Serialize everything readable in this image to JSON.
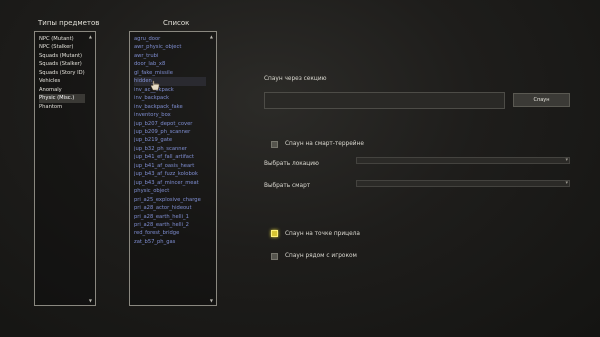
{
  "types_title": "Типы предметов",
  "list_title": "Список",
  "types": [
    "NPC (Mutant)",
    "NPC (Stalker)",
    "Squads (Mutant)",
    "Squads (Stalker)",
    "Squads (Story ID)",
    "Vehicles",
    "Anomaly",
    "Physic (Misc.)",
    "Phantom"
  ],
  "types_selected_index": 7,
  "items": [
    "agru_door",
    "awr_physic_object",
    "awr_trubi",
    "door_lab_x8",
    "gl_fake_missile",
    "hidden_",
    "inv_ac__ckpack",
    "inv_backpack",
    "inv_backpack_fake",
    "inventory_box",
    "jup_b207_depot_cover",
    "jup_b209_ph_scanner",
    "jup_b219_gate",
    "jup_b32_ph_scanner",
    "jup_b41_ef_fall_artifact",
    "jup_b41_af_oasis_heart",
    "jup_b43_af_fuzz_kolobok",
    "jup_b43_af_mincer_meat",
    "physic_object",
    "pri_a25_explosive_charge",
    "pri_a28_actor_hideout",
    "pri_a28_earth_helli_1",
    "pri_a28_earth_helli_2",
    "red_forest_bridge",
    "zat_b57_ph_gas"
  ],
  "items_hover_index": 5,
  "spawn_section_label": "Спаун через секцию",
  "spawn_section_value": "",
  "spawn_button": "Спаун",
  "smart_terrain_label": "Спаун на смарт-террейне",
  "choose_location_label": "Выбрать локацию",
  "choose_location_value": "",
  "choose_smart_label": "Выбрать смарт",
  "choose_smart_value": "",
  "crosshair_label": "Спаун на точке прицела",
  "near_player_label": "Спаун рядом с игроком",
  "checkboxes": {
    "smart_terrain": false,
    "crosshair": true,
    "near_player": false
  },
  "colors": {
    "item_text": "#7f8ed2",
    "checkbox_on": "#d8c532",
    "accent": "#e6d840"
  }
}
